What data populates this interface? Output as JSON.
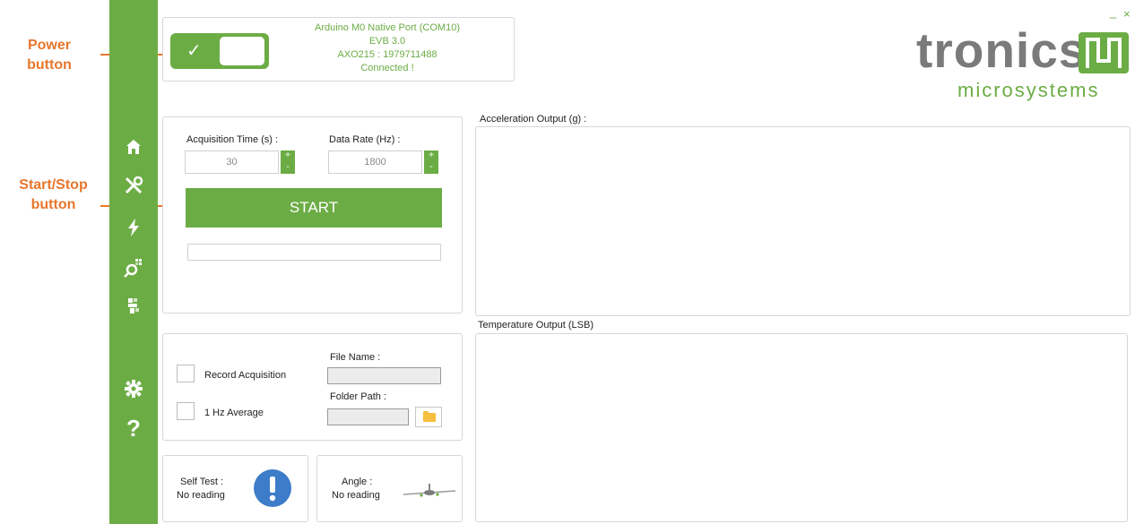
{
  "annotations": {
    "power": "Power\nbutton",
    "startstop": "Start/Stop\nbutton"
  },
  "connection": {
    "port": "Arduino M0 Native Port (COM10)",
    "board": "EVB 3.0",
    "device": "AXO215 : 1979711488",
    "status": "Connected !",
    "toggle_symbol": "✓"
  },
  "logo": {
    "word": "tronics",
    "sub": "microsystems"
  },
  "window": {
    "minimize": "_",
    "close": "×"
  },
  "acquisition": {
    "time_label": "Acquisition Time (s) :",
    "time_value": "30",
    "rate_label": "Data Rate (Hz) :",
    "rate_value": "1800",
    "plus": "+",
    "minus": "-",
    "start_label": "START",
    "progress": 0
  },
  "record": {
    "record_label": "Record Acquisition",
    "average_label": "1 Hz Average",
    "file_name_label": "File Name :",
    "folder_path_label": "Folder Path :"
  },
  "self_test": {
    "label": "Self Test :",
    "value": "No reading"
  },
  "angle": {
    "label": "Angle :",
    "value": "No reading"
  },
  "plots": {
    "acceleration_title": "Acceleration Output (g) :",
    "temperature_title": "Temperature Output (LSB)"
  },
  "colors": {
    "accent": "#6cac45",
    "annotation": "#e8762c",
    "info": "#3d7cc9"
  },
  "sidebar_icons": [
    "home-icon",
    "tools-icon",
    "lightning-icon",
    "search-chip-icon",
    "puzzle-icon",
    "gear-icon",
    "help-icon"
  ]
}
